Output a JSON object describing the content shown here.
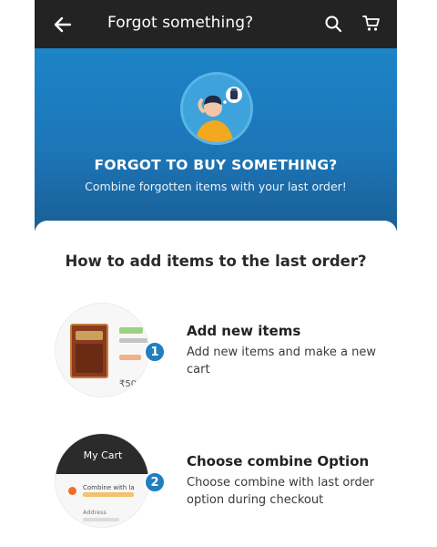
{
  "header": {
    "title": "Forgot something?",
    "back_icon": "arrow-left-icon",
    "search_icon": "search-icon",
    "cart_icon": "cart-icon"
  },
  "hero": {
    "title": "FORGOT TO BUY SOMETHING?",
    "subtitle": "Combine forgotten items with your last order!"
  },
  "section": {
    "title": "How to add items to the last order?"
  },
  "steps": [
    {
      "number": "1",
      "heading": "Add new items",
      "description": "Add new items and make a new cart",
      "thumb_price": "₹50"
    },
    {
      "number": "2",
      "heading": "Choose combine Option",
      "description": "Choose combine with last order option during checkout",
      "thumb_title": "My Cart",
      "thumb_option": "Combine with la",
      "thumb_address": "Address"
    }
  ],
  "colors": {
    "topbar": "#232323",
    "hero_blue": "#1d84c7",
    "badge_blue": "#1f7fc0",
    "accent_orange": "#f06b2b"
  }
}
